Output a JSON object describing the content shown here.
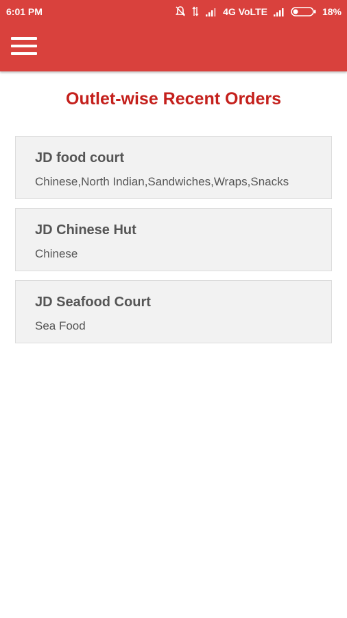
{
  "status_bar": {
    "time": "6:01 PM",
    "network": "4G VoLTE",
    "battery": "18%",
    "icons": [
      "mute-icon",
      "data-arrows-icon",
      "signal-icon",
      "signal-icon",
      "battery-icon"
    ]
  },
  "header": {
    "background_color": "#d9413d",
    "menu_icon": "hamburger-menu-icon"
  },
  "page": {
    "title": "Outlet-wise Recent Orders",
    "title_color": "#c4201c"
  },
  "outlets": [
    {
      "name": "JD food court",
      "cuisine": "Chinese,North Indian,Sandwiches,Wraps,Snacks"
    },
    {
      "name": "JD Chinese Hut",
      "cuisine": "Chinese"
    },
    {
      "name": "JD Seafood Court",
      "cuisine": "Sea Food"
    }
  ]
}
